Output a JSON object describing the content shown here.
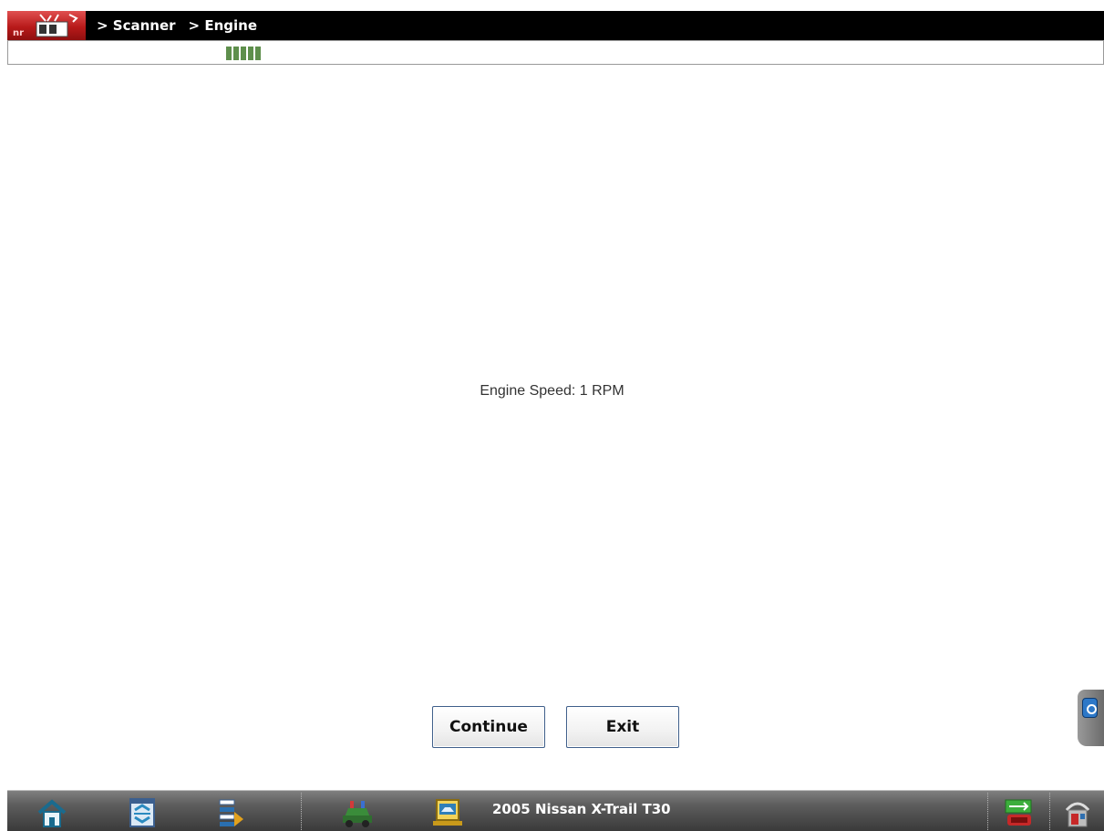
{
  "titlebar": {
    "breadcrumbs": [
      "> Scanner",
      "> Engine"
    ]
  },
  "progress": {
    "blocks": 5
  },
  "main": {
    "message": "Engine Speed: 1 RPM"
  },
  "buttons": {
    "continue_label": "Continue",
    "exit_label": "Exit"
  },
  "taskbar": {
    "vehicle": "2005 Nissan X-Trail T30",
    "icons": [
      "home-icon",
      "data-list-icon",
      "data-export-icon",
      "vehicle-id-icon",
      "vehicle-info-icon",
      "usb-connection-icon",
      "shop-icon"
    ]
  },
  "colors": {
    "titlebar_bg": "#000000",
    "logo_red": "#b81a1a",
    "progress_green": "#5e8f4c",
    "button_border": "#3f5f8a"
  }
}
